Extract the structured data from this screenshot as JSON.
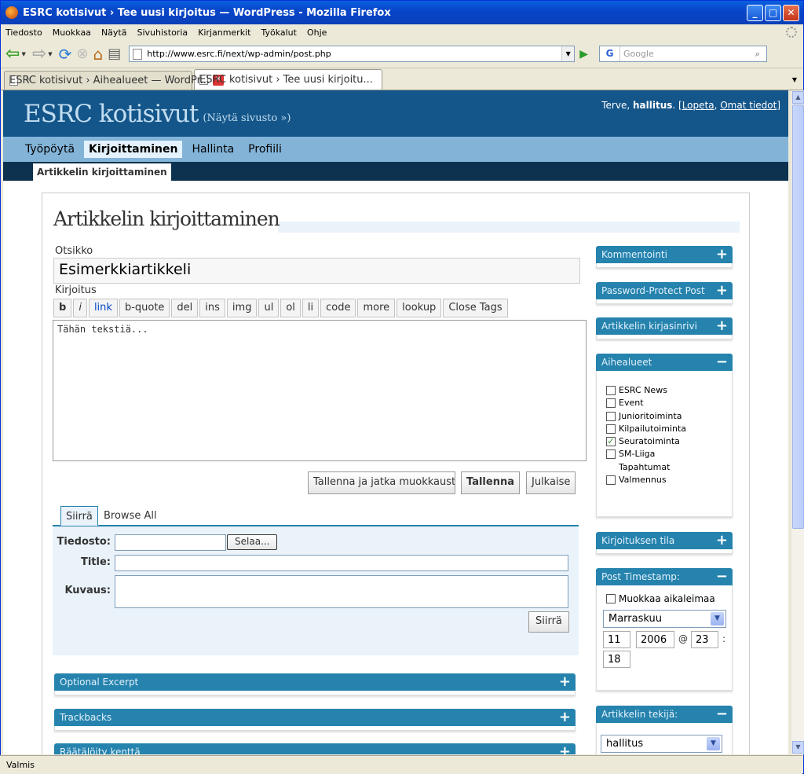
{
  "window": {
    "title": "ESRC kotisivut › Tee uusi kirjoitus — WordPress - Mozilla Firefox"
  },
  "menu": [
    "Tiedosto",
    "Muokkaa",
    "Näytä",
    "Sivuhistoria",
    "Kirjanmerkit",
    "Työkalut",
    "Ohje"
  ],
  "nav": {
    "url": "http://www.esrc.fi/next/wp-admin/post.php",
    "search_placeholder": "Google",
    "search_engine": "G"
  },
  "tabs": [
    {
      "label": "ESRC kotisivut › Aihealueet — WordPr..."
    },
    {
      "label": "ESRC kotisivut › Tee uusi kirjoitu..."
    }
  ],
  "wp": {
    "site_name": "ESRC kotisivut",
    "view_site": "(Näytä sivusto »)",
    "greeting": "Terve, ",
    "username": "hallitus",
    "logout": "Lopeta",
    "profile": "Omat tiedot",
    "menu": [
      "Työpöytä",
      "Kirjoittaminen",
      "Hallinta",
      "Profiili"
    ],
    "submenu": "Artikkelin kirjoittaminen"
  },
  "page": {
    "heading": "Artikkelin kirjoittaminen",
    "title_label": "Otsikko",
    "title_value": "Esimerkkiartikkeli",
    "content_label": "Kirjoitus",
    "quicktags": [
      "b",
      "i",
      "link",
      "b-quote",
      "del",
      "ins",
      "img",
      "ul",
      "ol",
      "li",
      "code",
      "more",
      "lookup",
      "Close Tags"
    ],
    "content_value": "Tähän tekstiä...",
    "save_continue": "Tallenna ja jatka muokkausta",
    "save": "Tallenna",
    "publish": "Julkaise"
  },
  "upload": {
    "tab_upload": "Siirrä",
    "tab_browse": "Browse All",
    "file_label": "Tiedosto:",
    "browse_btn": "Selaa...",
    "title_label": "Title:",
    "desc_label": "Kuvaus:",
    "submit": "Siirrä"
  },
  "boxes": {
    "excerpt": "Optional Excerpt",
    "trackbacks": "Trackbacks",
    "custom": "Räätälöity kenttä"
  },
  "sidebar": {
    "comments": "Kommentointi",
    "password": "Password-Protect Post",
    "slug": "Artikkelin kirjasinrivi",
    "categories": "Aihealueet",
    "category_items": [
      {
        "name": "ESRC News",
        "checked": false
      },
      {
        "name": "Event",
        "checked": false
      },
      {
        "name": "Junioritoiminta",
        "checked": false
      },
      {
        "name": "Kilpailutoiminta",
        "checked": false
      },
      {
        "name": "Seuratoiminta",
        "checked": true
      },
      {
        "name": "SM-Liiga",
        "checked": false
      },
      {
        "name": "Tapahtumat",
        "checked": false
      },
      {
        "name": "Valmennus",
        "checked": false
      }
    ],
    "status": "Kirjoituksen tila",
    "timestamp": "Post Timestamp:",
    "edit_timestamp": "Muokkaa aikaleimaa",
    "month": "Marraskuu",
    "day": "11",
    "year": "2006",
    "at": "@",
    "hour": "23",
    "colon": ":",
    "minute": "18",
    "author": "Artikkelin tekijä:",
    "author_value": "hallitus"
  },
  "statusbar": "Valmis"
}
